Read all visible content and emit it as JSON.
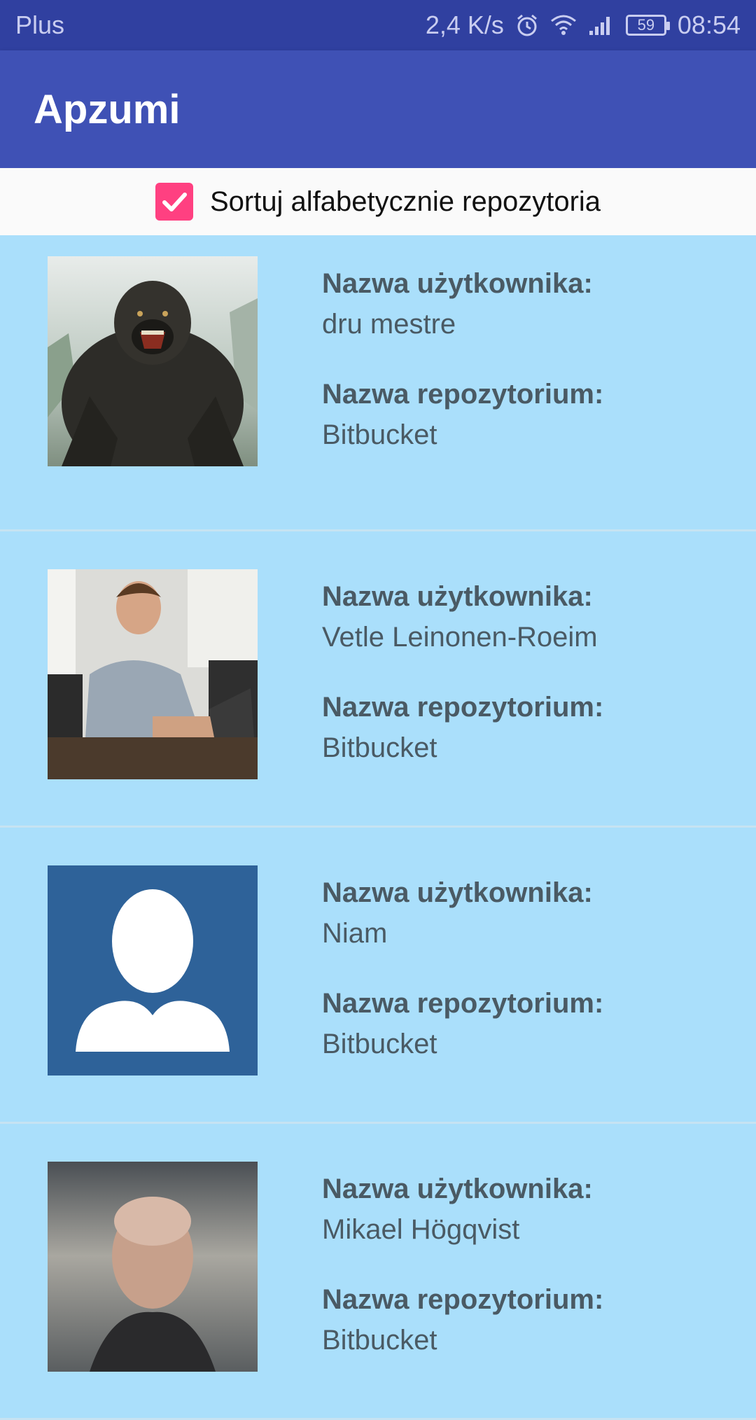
{
  "status_bar": {
    "carrier": "Plus",
    "speed": "2,4 K/s",
    "battery": "59",
    "time": "08:54"
  },
  "app_bar": {
    "title": "Apzumi"
  },
  "sort": {
    "label": "Sortuj alfabetycznie repozytoria",
    "checked": true
  },
  "list": {
    "user_label": "Nazwa użytkownika:",
    "repo_label": "Nazwa repozytorium:",
    "items": [
      {
        "user": "dru mestre",
        "repo": "Bitbucket",
        "avatar": "gorilla-photo"
      },
      {
        "user": "Vetle Leinonen-Roeim",
        "repo": "Bitbucket",
        "avatar": "man-at-laptop-photo"
      },
      {
        "user": "Niam",
        "repo": "Bitbucket",
        "avatar": "default-person-icon"
      },
      {
        "user": "Mikael Högqvist",
        "repo": "Bitbucket",
        "avatar": "man-portrait-photo"
      }
    ]
  }
}
